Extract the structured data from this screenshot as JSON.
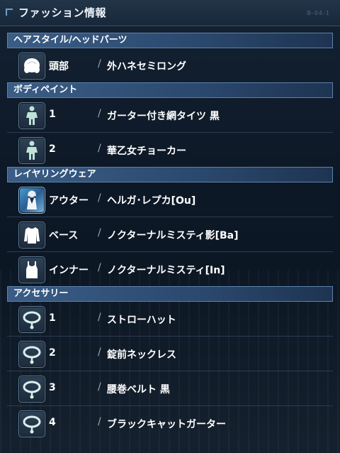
{
  "window": {
    "title": "ファッション情報",
    "corner_code": "B-04-1"
  },
  "sections": [
    {
      "header": "ヘアスタイル/ヘッドパーツ",
      "items": [
        {
          "label": "頭部",
          "sep": "/",
          "value": "外ハネセミロング",
          "icon": "hair-icon"
        }
      ]
    },
    {
      "header": "ボディペイント",
      "items": [
        {
          "label": "1",
          "sep": "/",
          "value": "ガーター付き網タイツ 黒",
          "icon": "body-paint-icon"
        },
        {
          "label": "2",
          "sep": "/",
          "value": "華乙女チョーカー",
          "icon": "body-paint-icon"
        }
      ]
    },
    {
      "header": "レイヤリングウェア",
      "items": [
        {
          "label": "アウター",
          "sep": "/",
          "value": "ヘルガ･レプカ[Ou]",
          "icon": "outer-portrait-icon"
        },
        {
          "label": "ベース",
          "sep": "/",
          "value": "ノクターナルミスティ影[Ba]",
          "icon": "shirt-icon"
        },
        {
          "label": "インナー",
          "sep": "/",
          "value": "ノクターナルミスティ[In]",
          "icon": "tank-top-icon"
        }
      ]
    },
    {
      "header": "アクセサリー",
      "items": [
        {
          "label": "1",
          "sep": "/",
          "value": "ストローハット",
          "icon": "accessory-icon"
        },
        {
          "label": "2",
          "sep": "/",
          "value": "錠前ネックレス",
          "icon": "accessory-icon"
        },
        {
          "label": "3",
          "sep": "/",
          "value": "腰巻ベルト 黒",
          "icon": "accessory-icon"
        },
        {
          "label": "4",
          "sep": "/",
          "value": "ブラックキャットガーター",
          "icon": "accessory-icon"
        }
      ]
    }
  ],
  "colors": {
    "header_bg": "#2c4a70",
    "panel_bg": "#0d1826",
    "text": "#ffffff"
  }
}
